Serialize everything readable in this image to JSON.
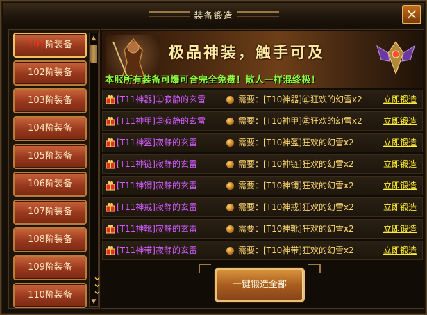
{
  "window": {
    "title": "装备锻造",
    "close_label": "×"
  },
  "tabs": [
    {
      "num": "101",
      "suffix": "阶装备"
    },
    {
      "num": "102",
      "suffix": "阶装备"
    },
    {
      "num": "103",
      "suffix": "阶装备"
    },
    {
      "num": "104",
      "suffix": "阶装备"
    },
    {
      "num": "105",
      "suffix": "阶装备"
    },
    {
      "num": "106",
      "suffix": "阶装备"
    },
    {
      "num": "107",
      "suffix": "阶装备"
    },
    {
      "num": "108",
      "suffix": "阶装备"
    },
    {
      "num": "109",
      "suffix": "阶装备"
    },
    {
      "num": "110",
      "suffix": "阶装备"
    }
  ],
  "banner": {
    "title": "极品神装，触手可及",
    "subtitle": "本服所有装备可爆可合完全免费！散人一样混终极！"
  },
  "rows": [
    {
      "item": "[T11神器]㊣寂静的玄雷",
      "need": "需要：[T10神器]㊣狂欢的幻雪x2",
      "action": "立即锻造"
    },
    {
      "item": "[T11神甲]㊣寂静的玄雷",
      "need": "需要：[T10神甲]㊣狂欢的幻雪x2",
      "action": "立即锻造"
    },
    {
      "item": "[T11神盔]寂静的玄雷",
      "need": "需要：[T10神盔]狂欢的幻雪x2",
      "action": "立即锻造"
    },
    {
      "item": "[T11神链]寂静的玄雷",
      "need": "需要：[T10神链]狂欢的幻雪x2",
      "action": "立即锻造"
    },
    {
      "item": "[T11神镯]寂静的玄雷",
      "need": "需要：[T10神镯]狂欢的幻雪x2",
      "action": "立即锻造"
    },
    {
      "item": "[T11神戒]寂静的玄雷",
      "need": "需要：[T10神戒]狂欢的幻雪x2",
      "action": "立即锻造"
    },
    {
      "item": "[T11神靴]寂静的玄雷",
      "need": "需要：[T10神靴]狂欢的幻雪x2",
      "action": "立即锻造"
    },
    {
      "item": "[T11神带]寂静的玄雷",
      "need": "需要：[T10神带]狂欢的幻雪x2",
      "action": "立即锻造"
    }
  ],
  "forge_all_label": "一键锻造全部",
  "colors": {
    "item_name": "#d25cff",
    "need_text": "#ffd870",
    "action_link": "#ffee33",
    "subtitle": "#8cff40",
    "active_tab_num": "#ff3020"
  },
  "icons": {
    "row_icon": "gift-icon",
    "need_icon": "gold-dot-icon",
    "close": "close-icon",
    "scroll_more": "chevron-down-icon"
  }
}
